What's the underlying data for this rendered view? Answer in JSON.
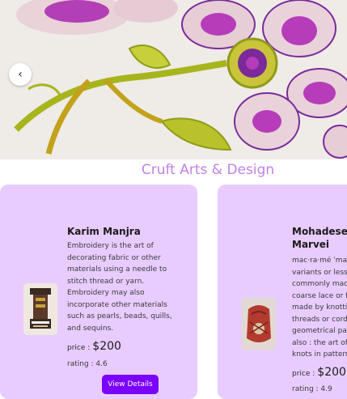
{
  "section": {
    "title": "Cruft Arts & Design"
  },
  "carousel": {
    "prev_symbol": "‹"
  },
  "cards": [
    {
      "name": "Karim Manjra",
      "description": "Embroidery is the art of decorating fabric or other materials using a needle to stitch thread or yarn. Embroidery may also incorporate other materials such as pearls, beads, quills, and sequins.",
      "price_label": "price :",
      "price": "$200",
      "rating": "rating : 4.6",
      "button": "View Details"
    },
    {
      "name": "Mohadese - Marvei",
      "description_lines": [
        "mac·ra·mé ˈma-",
        "variants or less",
        "commonly mac",
        "coarse lace or f",
        "made by knotti",
        "threads or cord",
        "geometrical pat",
        "also : the art of",
        "knots in pattern"
      ],
      "price_label": "price :",
      "price": "$200",
      "rating": "rating : 4.9"
    }
  ],
  "colors": {
    "accent": "#7a00ff",
    "card_bg": "#e8ccff",
    "title": "#c182e8"
  }
}
